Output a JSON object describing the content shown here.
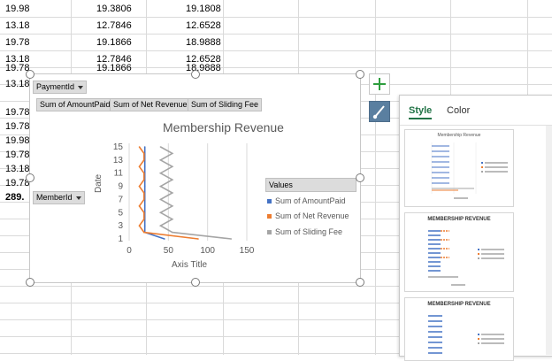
{
  "sheet": {
    "rows": [
      {
        "a": "19.98",
        "b": "19.3806",
        "c": "19.1808"
      },
      {
        "a": "13.18",
        "b": "12.7846",
        "c": "12.6528"
      },
      {
        "a": "19.78",
        "b": "19.1866",
        "c": "18.9888"
      },
      {
        "a": "13.18",
        "b": "12.7846",
        "c": "12.6528"
      },
      {
        "a": "19.78",
        "b": "19.1866",
        "c": "18.9888"
      },
      {
        "a": "13.18",
        "b": "",
        "c": ""
      },
      {
        "a": "19.78",
        "b": "",
        "c": ""
      },
      {
        "a": "19.78",
        "b": "",
        "c": ""
      },
      {
        "a": "19.98",
        "b": "",
        "c": ""
      },
      {
        "a": "19.78",
        "b": "",
        "c": ""
      },
      {
        "a": "13.18",
        "b": "",
        "c": ""
      },
      {
        "a": "19.78",
        "b": "",
        "c": ""
      },
      {
        "a": "289.",
        "b": "",
        "c": ""
      }
    ]
  },
  "chart": {
    "filter_field": "PaymentId",
    "value_fields": [
      "Sum of AmountPaid",
      "Sum of Net Revenue",
      "Sum of Sliding Fee"
    ],
    "axis_field": "MemberId",
    "legend_title": "Values",
    "x_axis_title": "Axis Title",
    "y_axis_title": "Date"
  },
  "chart_data": {
    "type": "line",
    "title": "Membership Revenue",
    "xlabel": "Axis Title",
    "ylabel": "Date",
    "orientation": "horizontal",
    "xlim": [
      0,
      150
    ],
    "x_ticks": [
      "0",
      "50",
      "100",
      "150"
    ],
    "y_ticks": [
      "1",
      "3",
      "5",
      "7",
      "9",
      "11",
      "13",
      "15"
    ],
    "categories": [
      "1",
      "2",
      "3",
      "4",
      "5",
      "6",
      "7",
      "8",
      "9",
      "10",
      "11",
      "12",
      "13",
      "14",
      "15"
    ],
    "series": [
      {
        "name": "Sum of AmountPaid",
        "color": "#4472c4",
        "values": [
          45,
          20,
          20,
          20,
          20,
          20,
          20,
          20,
          20,
          20,
          20,
          20,
          20,
          20,
          20
        ]
      },
      {
        "name": "Sum of Net Revenue",
        "color": "#ed7d31",
        "values": [
          88,
          19,
          13,
          19,
          19,
          13,
          19,
          19,
          13,
          19,
          19,
          13,
          19,
          19,
          13
        ]
      },
      {
        "name": "Sum of Sliding Fee",
        "color": "#a5a5a5",
        "values": [
          130,
          55,
          40,
          55,
          40,
          55,
          40,
          55,
          40,
          55,
          40,
          55,
          40,
          55,
          40
        ]
      }
    ],
    "grid": true,
    "legend": "right"
  },
  "styles_pane": {
    "tabs": [
      "Style",
      "Color"
    ],
    "active_tab": "Style",
    "thumbs": [
      {
        "title": "Membership Revenue"
      },
      {
        "title": "MEMBERSHIP REVENUE"
      },
      {
        "title": "MEMBERSHIP REVENUE"
      }
    ]
  },
  "colors": {
    "accent": "#217346",
    "brush_button": "#5a7fa0",
    "plus": "#2e9e3e"
  }
}
